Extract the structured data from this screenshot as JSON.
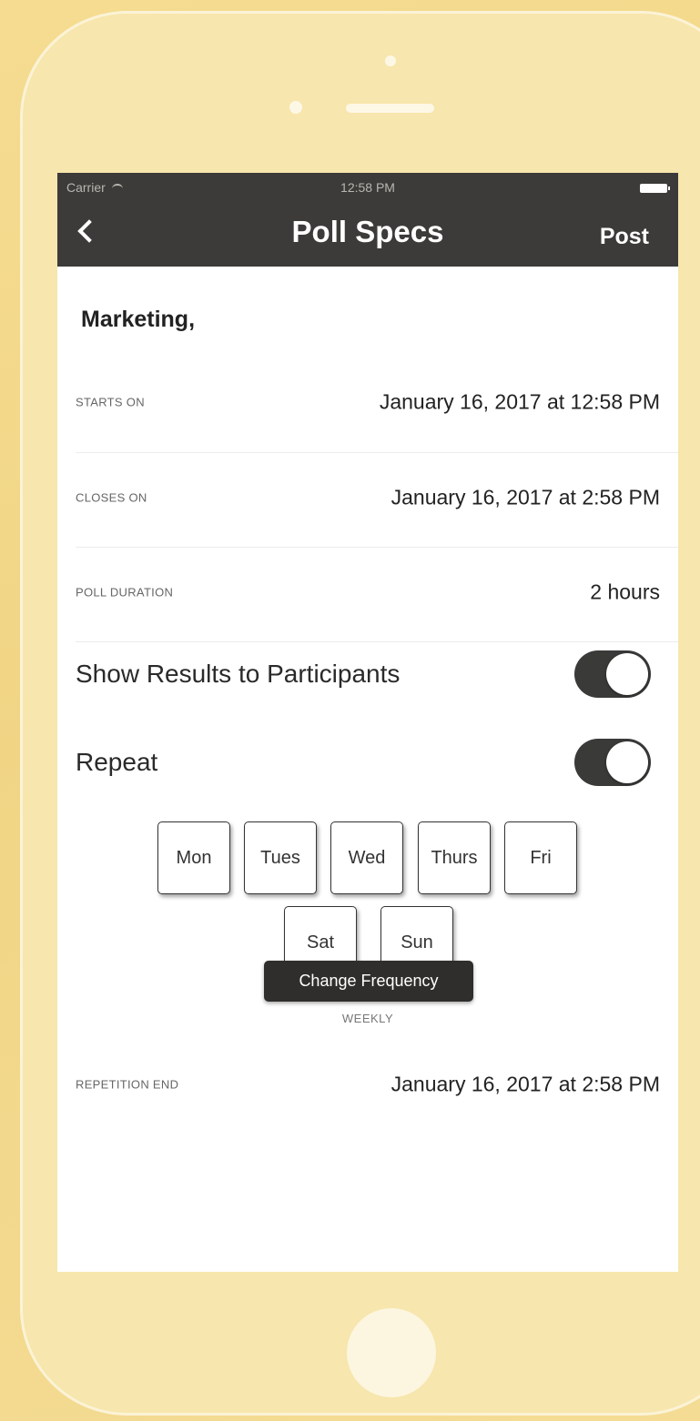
{
  "status_bar": {
    "carrier": "Carrier",
    "time": "12:58 PM"
  },
  "navbar": {
    "title": "Poll Specs",
    "post_label": "Post"
  },
  "poll": {
    "group_name": "Marketing,",
    "starts_on_label": "STARTS ON",
    "starts_on_value": "January 16, 2017 at 12:58 PM",
    "closes_on_label": "CLOSES ON",
    "closes_on_value": "January 16, 2017 at 2:58 PM",
    "duration_label": "POLL DURATION",
    "duration_value": "2 hours",
    "show_results_label": "Show Results to Participants",
    "show_results_on": true,
    "repeat_label": "Repeat",
    "repeat_on": true,
    "days": [
      "Mon",
      "Tues",
      "Wed",
      "Thurs",
      "Fri",
      "Sat",
      "Sun"
    ],
    "change_frequency_label": "Change Frequency",
    "frequency_value": "WEEKLY",
    "repetition_end_label": "REPETITION END",
    "repetition_end_value": "January 16, 2017 at 2:58 PM"
  },
  "colors": {
    "background": "#f3d98c",
    "navbar": "#3c3b39",
    "toggle_on": "#3a3a38"
  },
  "icons": {
    "back": "chevron-left-icon",
    "wifi": "wifi-icon",
    "battery": "battery-icon"
  }
}
